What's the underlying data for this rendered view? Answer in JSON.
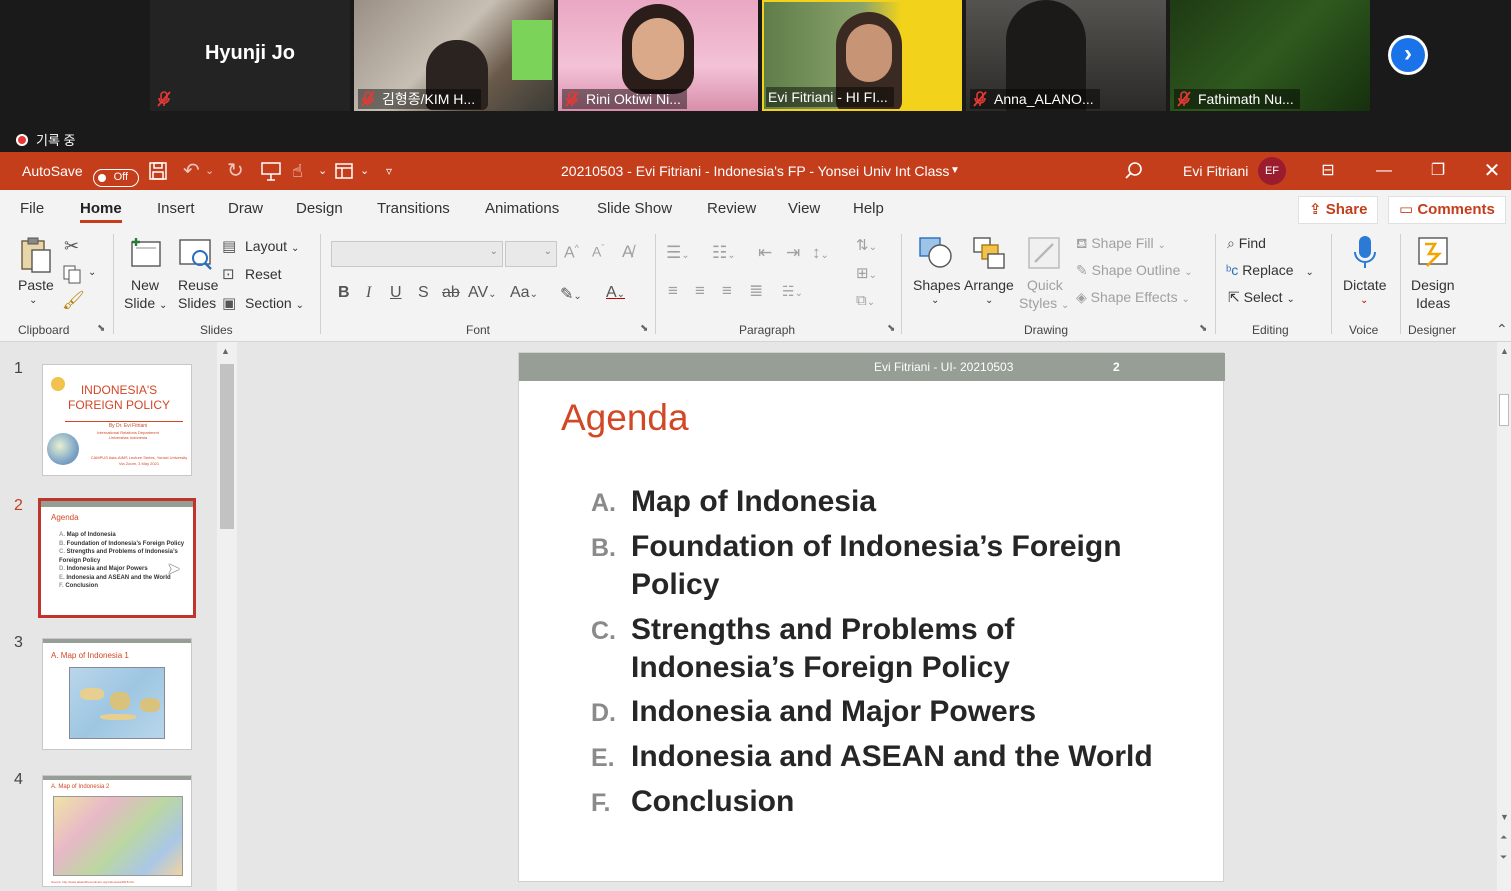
{
  "zoom": {
    "participants": [
      {
        "name": "Hyunji Jo",
        "muted": true
      },
      {
        "name": "김형종/KIM H...",
        "muted": true
      },
      {
        "name": "Rini Oktiwi Ni...",
        "muted": true
      },
      {
        "name": "Evi Fitriani - HI FI...",
        "muted": false
      },
      {
        "name": "Anna_ALANO...",
        "muted": true
      },
      {
        "name": "Fathimath Nu...",
        "muted": true
      }
    ],
    "recording_label": "기록 중"
  },
  "titlebar": {
    "autosave_label": "AutoSave",
    "autosave_state": "Off",
    "document_title": "20210503 - Evi Fitriani - Indonesia's FP - Yonsei Univ Int Class",
    "user_name": "Evi Fitriani",
    "user_initials": "EF"
  },
  "tabs": [
    "File",
    "Home",
    "Insert",
    "Draw",
    "Design",
    "Transitions",
    "Animations",
    "Slide Show",
    "Review",
    "View",
    "Help"
  ],
  "active_tab": "Home",
  "share_label": "Share",
  "comments_label": "Comments",
  "ribbon": {
    "clipboard": {
      "paste": "Paste",
      "label": "Clipboard"
    },
    "slides": {
      "new_slide_1": "New",
      "new_slide_2": "Slide",
      "reuse_1": "Reuse",
      "reuse_2": "Slides",
      "layout": "Layout",
      "reset": "Reset",
      "section": "Section",
      "label": "Slides"
    },
    "font": {
      "label": "Font"
    },
    "paragraph": {
      "label": "Paragraph"
    },
    "drawing": {
      "shapes": "Shapes",
      "arrange": "Arrange",
      "quick_1": "Quick",
      "quick_2": "Styles",
      "shape_fill": "Shape Fill",
      "shape_outline": "Shape Outline",
      "shape_effects": "Shape Effects",
      "label": "Drawing"
    },
    "editing": {
      "find": "Find",
      "replace": "Replace",
      "select": "Select",
      "label": "Editing"
    },
    "voice": {
      "dictate": "Dictate",
      "label": "Voice"
    },
    "designer": {
      "design_1": "Design",
      "design_2": "Ideas",
      "label": "Designer"
    }
  },
  "thumbnails": [
    {
      "number": "1",
      "title": "INDONESIA'S FOREIGN POLICY",
      "author": "By Dr. Evi Fitriani",
      "sub1": "International Relations Department",
      "sub2": "Universitas Indonesia",
      "foot1": "CAMPUS Asia-AIMS Lecture Series, Yonsei University",
      "foot2": "Via Zoom, 3 May 2021"
    },
    {
      "number": "2",
      "title": "Agenda"
    },
    {
      "number": "3",
      "title": "A. Map of Indonesia 1"
    },
    {
      "number": "4",
      "title": "A. Map of Indonesia 2",
      "source": "Source: http://www.atlasofthecontinent.org/indonesia/2018.htm"
    }
  ],
  "slide": {
    "header": "Evi Fitriani - UI- 20210503",
    "page_number": "2",
    "title": "Agenda",
    "items": [
      {
        "letter": "A.",
        "text": "Map of  Indonesia"
      },
      {
        "letter": "B.",
        "text": "Foundation of Indonesia’s Foreign Policy"
      },
      {
        "letter": "C.",
        "text": "Strengths and Problems of Indonesia’s Foreign Policy"
      },
      {
        "letter": "D.",
        "text": "Indonesia and Major Powers"
      },
      {
        "letter": "E.",
        "text": "Indonesia and ASEAN and the World"
      },
      {
        "letter": "F.",
        "text": "Conclusion"
      }
    ]
  },
  "colors": {
    "accent": "#c43e1c",
    "slide_title": "#d24726",
    "header_bar": "#969e96",
    "zoom_bg": "#1a1a1a"
  }
}
